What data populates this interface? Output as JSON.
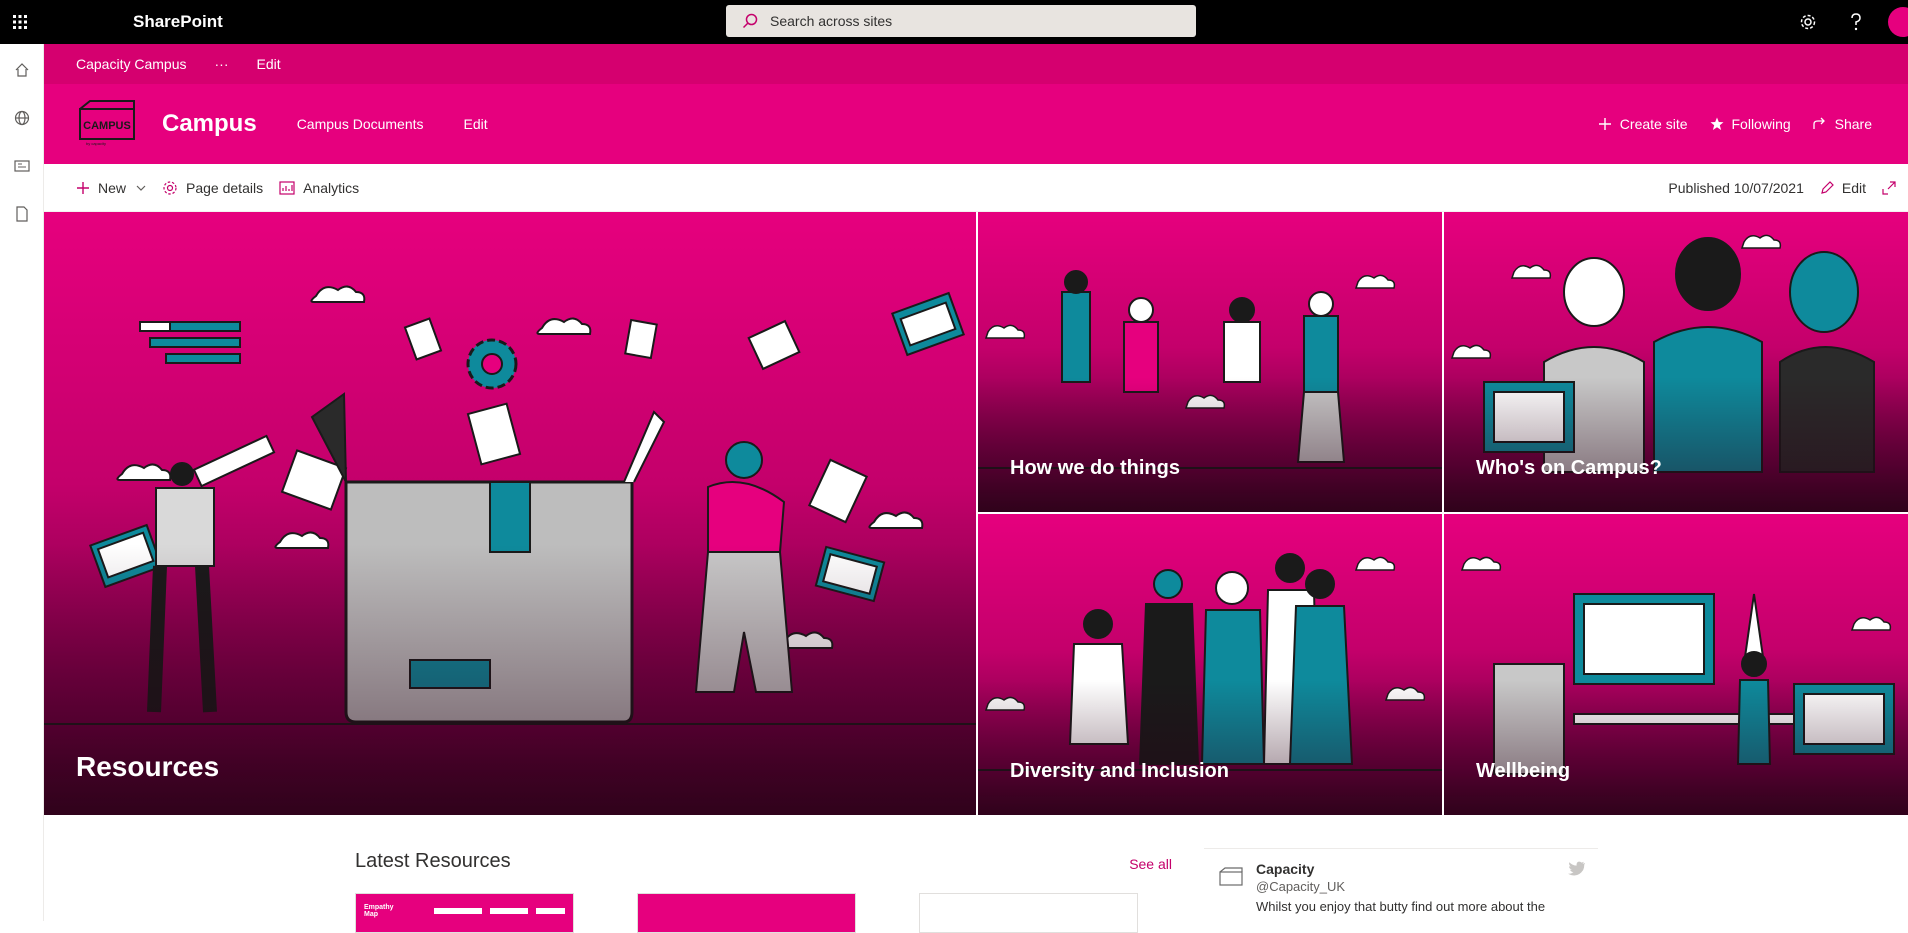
{
  "topbar": {
    "brand": "SharePoint",
    "search_placeholder": "Search across sites"
  },
  "hub": {
    "site_name": "Capacity Campus",
    "more": "···",
    "edit": "Edit"
  },
  "site": {
    "title": "Campus",
    "nav": [
      "Campus Documents",
      "Edit"
    ],
    "actions": {
      "create_site": "Create site",
      "following": "Following",
      "share": "Share"
    }
  },
  "commandbar": {
    "new": "New",
    "page_details": "Page details",
    "analytics": "Analytics",
    "published": "Published 10/07/2021",
    "edit": "Edit"
  },
  "hero": {
    "tiles": [
      "Resources",
      "How we do things",
      "Who's on Campus?",
      "Diversity and Inclusion",
      "Wellbeing"
    ]
  },
  "latest": {
    "title": "Latest Resources",
    "see_all": "See all",
    "card1_label": "Empathy Map"
  },
  "tweet": {
    "name": "Capacity",
    "handle": "@Capacity_UK",
    "text": "Whilst you enjoy that butty find out more about the"
  },
  "colors": {
    "brand": "#e6007e",
    "hub": "#d5006f",
    "accent_teal": "#0e8a9c"
  }
}
